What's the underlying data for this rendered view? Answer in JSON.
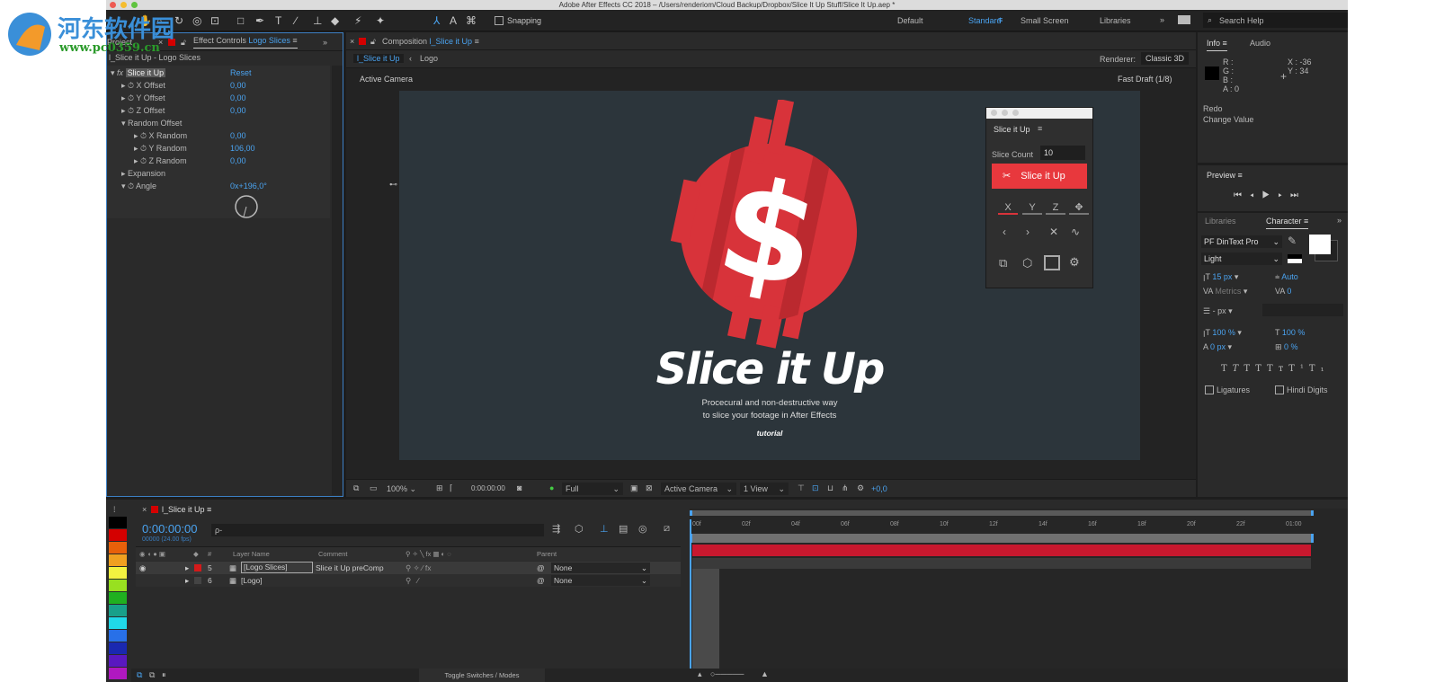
{
  "window": {
    "title": "Adobe After Effects CC 2018 – /Users/renderiom/Cloud Backup/Dropbox/Slice It Up Stuff/Slice It Up.aep *"
  },
  "watermark": {
    "text": "河东软件园",
    "url": "www.pc0359.cn"
  },
  "toolbar": {
    "snapping": "Snapping"
  },
  "workspaces": [
    "Default",
    "Standard",
    "Small Screen",
    "Libraries"
  ],
  "active_workspace": "Standard",
  "search_help": "Search Help",
  "effect_panel": {
    "tab_project": "Project",
    "tab_label": "Effect Controls",
    "tab_layer": "Logo Slices",
    "breadcrumb": "l_Slice it Up - Logo Slices",
    "effect_name": "Slice it Up",
    "reset": "Reset",
    "props": [
      {
        "label": "X Offset",
        "value": "0,00"
      },
      {
        "label": "Y Offset",
        "value": "0,00"
      },
      {
        "label": "Z Offset",
        "value": "0,00"
      },
      {
        "label": "Random Offset",
        "value": ""
      },
      {
        "label": "X Random",
        "value": "0,00"
      },
      {
        "label": "Y Random",
        "value": "106,00"
      },
      {
        "label": "Z Random",
        "value": "0,00"
      },
      {
        "label": "Expansion",
        "value": ""
      },
      {
        "label": "Angle",
        "value": "0x+196,0°"
      }
    ]
  },
  "comp": {
    "tab_label": "Composition",
    "tab_name": "l_Slice it Up",
    "crumbs": [
      "l_Slice it Up",
      "Logo"
    ],
    "renderer_label": "Renderer:",
    "renderer": "Classic 3D",
    "camera_label": "Active Camera",
    "draft": "Fast Draft (1/8)",
    "artwork": {
      "title": "Slice it Up",
      "line1": "Procecural and non-destructive way",
      "line2": "to slice your footage in After Effects",
      "line3": "tutorial"
    },
    "footer": {
      "zoom": "100%",
      "time": "0:00:00:00",
      "resolution": "Full",
      "camera": "Active Camera",
      "views": "1 View",
      "exposure": "+0,0"
    }
  },
  "plugin": {
    "title": "Slice it Up",
    "slice_count_label": "Slice Count",
    "slice_count": "10",
    "button": "Slice it Up",
    "axes": [
      "X",
      "Y",
      "Z"
    ],
    "accent": "#e8383d"
  },
  "info": {
    "tab": "Info",
    "tab2": "Audio",
    "r": "R :",
    "g": "G :",
    "b": "B :",
    "a": "A :  0",
    "x": "X : -36",
    "y": "Y : 34",
    "history1": "Redo",
    "history2": "Change Value"
  },
  "preview": {
    "title": "Preview"
  },
  "character": {
    "tab1": "Libraries",
    "tab2": "Character",
    "font": "PF DinText Pro",
    "style": "Light",
    "size": "15 px",
    "leading": "Auto",
    "kerning": "Metrics",
    "tracking": "0",
    "stroke": "- px",
    "vscale": "100 %",
    "hscale": "100 %",
    "baseline": "0 px",
    "tsume": "0 %",
    "ligatures": "Ligatures",
    "hindi": "Hindi Digits"
  },
  "timeline": {
    "tab": "l_Slice it Up",
    "timecode": "0:00:00:00",
    "fps": "00000 (24.00 fps)",
    "search_placeholder": "ρ-",
    "columns": {
      "num": "#",
      "name": "Layer Name",
      "comment": "Comment",
      "parent": "Parent"
    },
    "layers": [
      {
        "num": "5",
        "name": "[Logo Slices]",
        "comment": "Slice it Up preComp",
        "parent": "None",
        "color": "#d41a1a"
      },
      {
        "num": "6",
        "name": "[Logo]",
        "comment": "",
        "parent": "None",
        "color": "#444444"
      }
    ],
    "ruler": [
      "00f",
      "02f",
      "04f",
      "06f",
      "08f",
      "10f",
      "12f",
      "14f",
      "16f",
      "18f",
      "20f",
      "22f",
      "01:00"
    ],
    "toggle": "Toggle Switches / Modes"
  },
  "label_colors": [
    "#000000",
    "#d40000",
    "#e8600a",
    "#f0a020",
    "#f2f240",
    "#98e020",
    "#20b020",
    "#18a08a",
    "#20d8e8",
    "#2870e8",
    "#1a28b0",
    "#5a18c0",
    "#b018c0"
  ]
}
